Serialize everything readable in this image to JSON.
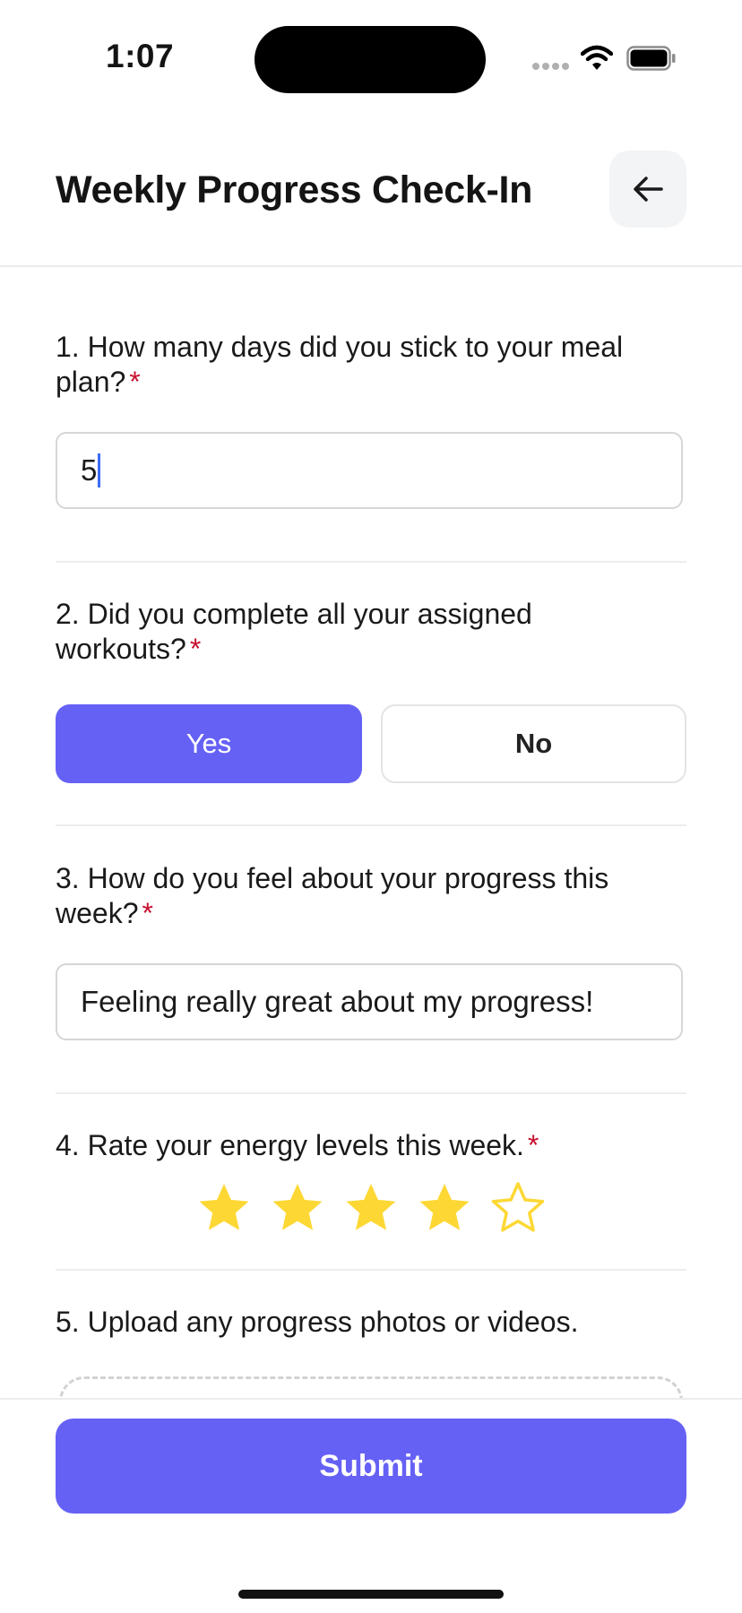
{
  "status_bar": {
    "time": "1:07"
  },
  "header": {
    "title": "Weekly Progress Check-In",
    "back_icon": "arrow-left-icon"
  },
  "questions": {
    "q1": {
      "label": "1. How many days did you stick to your meal plan?",
      "required_mark": "*",
      "value": "5"
    },
    "q2": {
      "label": "2. Did  you complete all your assigned workouts?",
      "required_mark": "*",
      "options": [
        "Yes",
        "No"
      ],
      "selected": "Yes"
    },
    "q3": {
      "label": "3. How do you feel about your progress this week?",
      "required_mark": "*",
      "value": "Feeling really great about my progress!"
    },
    "q4": {
      "label": "4. Rate your energy levels this week.",
      "required_mark": "*",
      "rating": 4,
      "max_rating": 5
    },
    "q5": {
      "label": "5. Upload any progress photos or videos."
    }
  },
  "footer": {
    "submit_label": "Submit"
  },
  "colors": {
    "accent": "#6661f5",
    "required": "#c8102e",
    "star_filled": "#fdd835",
    "caret": "#3b6cf6"
  }
}
